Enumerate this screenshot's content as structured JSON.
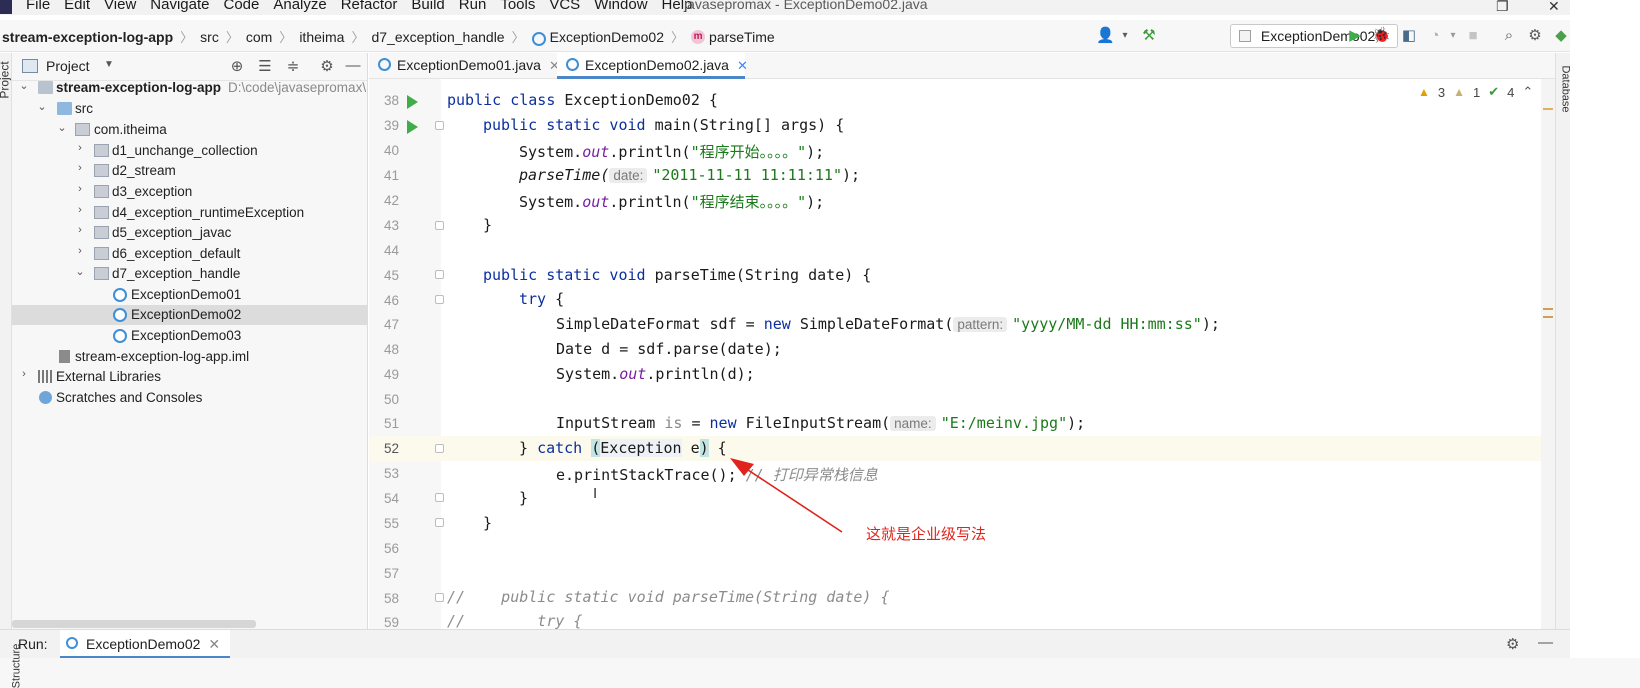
{
  "menubar": {
    "items": [
      "File",
      "Edit",
      "View",
      "Navigate",
      "Code",
      "Analyze",
      "Refactor",
      "Build",
      "Run",
      "Tools",
      "VCS",
      "Window",
      "Help"
    ],
    "window_title": "javasepromax - ExceptionDemo02.java"
  },
  "navbar": {
    "crumbs": [
      "stream-exception-log-app",
      "src",
      "com",
      "itheima",
      "d7_exception_handle",
      "ExceptionDemo02",
      "parseTime"
    ],
    "run_config": "ExceptionDemo02"
  },
  "project": {
    "title": "Project",
    "tree": [
      {
        "label": "stream-exception-log-app",
        "extra": "D:\\code\\javasepromax\\",
        "icon": "module-folder-icon",
        "arrow": "down"
      },
      {
        "label": "src",
        "icon": "source-folder-icon",
        "arrow": "down"
      },
      {
        "label": "com.itheima",
        "icon": "package-icon",
        "arrow": "down"
      },
      {
        "label": "d1_unchange_collection",
        "icon": "package-icon",
        "arrow": "right"
      },
      {
        "label": "d2_stream",
        "icon": "package-icon",
        "arrow": "right"
      },
      {
        "label": "d3_exception",
        "icon": "package-icon",
        "arrow": "right"
      },
      {
        "label": "d4_exception_runtimeException",
        "icon": "package-icon",
        "arrow": "right"
      },
      {
        "label": "d5_exception_javac",
        "icon": "package-icon",
        "arrow": "right"
      },
      {
        "label": "d6_exception_default",
        "icon": "package-icon",
        "arrow": "right"
      },
      {
        "label": "d7_exception_handle",
        "icon": "package-icon",
        "arrow": "down"
      },
      {
        "label": "ExceptionDemo01",
        "icon": "class-icon",
        "arrow": ""
      },
      {
        "label": "ExceptionDemo02",
        "icon": "class-icon",
        "arrow": "",
        "selected": true
      },
      {
        "label": "ExceptionDemo03",
        "icon": "class-icon",
        "arrow": ""
      },
      {
        "label": "stream-exception-log-app.iml",
        "icon": "iml-file-icon",
        "arrow": ""
      },
      {
        "label": "External Libraries",
        "icon": "libraries-icon",
        "arrow": "right"
      },
      {
        "label": "Scratches and Consoles",
        "icon": "scratches-icon",
        "arrow": ""
      }
    ]
  },
  "editor": {
    "tabs": [
      {
        "label": "ExceptionDemo01.java",
        "active": false
      },
      {
        "label": "ExceptionDemo02.java",
        "active": true
      }
    ],
    "inspections": {
      "warnings": "3",
      "weak_warnings": "1",
      "typos": "4"
    },
    "line_numbers": [
      "38",
      "39",
      "40",
      "41",
      "42",
      "43",
      "44",
      "45",
      "46",
      "47",
      "48",
      "49",
      "50",
      "51",
      "52",
      "53",
      "54",
      "55",
      "56",
      "57",
      "58",
      "59"
    ],
    "code": {
      "l38_kw": "public class ",
      "l38_rest": "ExceptionDemo02 {",
      "l39_kw": "public static void ",
      "l39_rest": "main(String[] args) {",
      "l40_a": "System.",
      "l40_field": "out",
      "l40_b": ".println(",
      "l40_str": "\"程序开始。。。。\"",
      "l40_c": ");",
      "l41_call": "parseTime(",
      "l41_hint": "date:",
      "l41_str": "\"2011-11-11 11:11:11\"",
      "l41_c": ");",
      "l42_a": "System.",
      "l42_field": "out",
      "l42_b": ".println(",
      "l42_str": "\"程序结束。。。。\"",
      "l42_c": ");",
      "l43": "}",
      "l45_kw": "public static void ",
      "l45_rest": "parseTime(String date) {",
      "l46_kw": "try",
      "l46_rest": " {",
      "l47_a": "SimpleDateFormat sdf = ",
      "l47_kw": "new",
      "l47_b": " SimpleDateFormat(",
      "l47_hint": "pattern:",
      "l47_str": "\"yyyy/MM-dd HH:mm:ss\"",
      "l47_c": ");",
      "l48": "Date d = sdf.parse(date);",
      "l49_a": "System.",
      "l49_field": "out",
      "l49_b": ".println(d);",
      "l51_a": "InputStream ",
      "l51_var": "is",
      "l51_b": " = ",
      "l51_kw": "new",
      "l51_c": " FileInputStream(",
      "l51_hint": "name:",
      "l51_str": "\"E:/meinv.jpg\"",
      "l51_d": ");",
      "l52_a": "} ",
      "l52_kw": "catch",
      "l52_sp": " ",
      "l52_lp": "(",
      "l52_type": "Exception",
      "l52_sp2": " e",
      "l52_rp": ")",
      "l52_b": " {",
      "l53_a": "e.printStackTrace(); ",
      "l53_cmt": "// 打印异常栈信息",
      "l54": "}",
      "l55": "}",
      "l58_cmt": "//    public static void parseTime(String date) {",
      "l59_cmt": "//        try {"
    }
  },
  "annotation": {
    "text": "这就是企业级写法",
    "color": "#e0241c"
  },
  "run_bar": {
    "label": "Run:",
    "tab": "ExceptionDemo02"
  },
  "side_labels": {
    "left": "Project",
    "right": "Database",
    "bottom": "Structure"
  },
  "colors": {
    "keyword": "#0b2f9e",
    "string": "#1a7a1a",
    "field": "#7a1ea1",
    "comment": "#8c8c8c",
    "run_green": "#3fae4a",
    "tab_underline": "#4a86c8"
  }
}
